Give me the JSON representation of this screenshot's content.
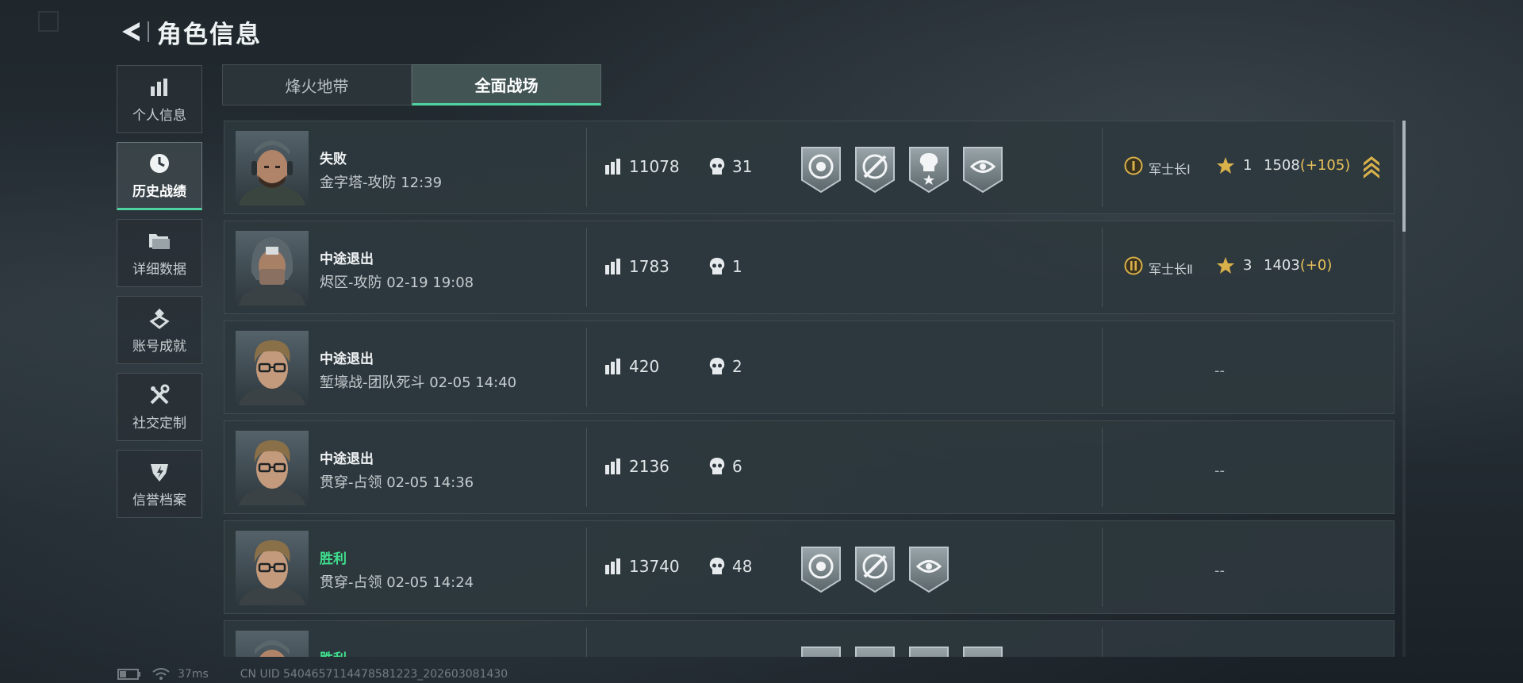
{
  "header": {
    "title": "角色信息",
    "back_icon": "back-arrow-icon"
  },
  "sidebar": {
    "items": [
      {
        "label": "个人信息",
        "icon": "bar-chart-icon",
        "active": false
      },
      {
        "label": "历史战绩",
        "icon": "clock-icon",
        "active": true
      },
      {
        "label": "详细数据",
        "icon": "folder-icon",
        "active": false
      },
      {
        "label": "账号成就",
        "icon": "achievement-icon",
        "active": false
      },
      {
        "label": "社交定制",
        "icon": "tools-icon",
        "active": false
      },
      {
        "label": "信誉档案",
        "icon": "reputation-icon",
        "active": false
      }
    ]
  },
  "tabs": [
    {
      "label": "烽火地带",
      "active": false
    },
    {
      "label": "全面战场",
      "active": true
    }
  ],
  "matches": [
    {
      "result": "失败",
      "info": "金字塔-攻防 12:39",
      "score": "11078",
      "kills": "31",
      "medals": [
        "target-skull-medal-icon",
        "crosshair-rifle-medal-icon",
        "skull-star-medal-icon",
        "eye-scope-medal-icon"
      ],
      "rank": {
        "name": "军士长Ⅰ",
        "stars": "1",
        "rating": "1508",
        "delta": "(+105)"
      }
    },
    {
      "result": "中途退出",
      "info": "烬区-攻防 02-19 19:08",
      "score": "1783",
      "kills": "1",
      "medals": [],
      "rank": {
        "name": "军士长Ⅱ",
        "stars": "3",
        "rating": "1403",
        "delta": "(+0)"
      }
    },
    {
      "result": "中途退出",
      "info": "堑壕战-团队死斗 02-05 14:40",
      "score": "420",
      "kills": "2",
      "medals": [],
      "rank_empty": "--"
    },
    {
      "result": "中途退出",
      "info": "贯穿-占领 02-05 14:36",
      "score": "2136",
      "kills": "6",
      "medals": [],
      "rank_empty": "--"
    },
    {
      "result": "胜利",
      "info": "贯穿-占领 02-05 14:24",
      "score": "13740",
      "kills": "48",
      "medals": [
        "target-skull-medal-icon",
        "crosshair-rifle-medal-icon",
        "eye-scope-medal-icon"
      ],
      "rank_empty": "--"
    },
    {
      "result": "胜利",
      "info": "",
      "score": "",
      "kills": "",
      "medals": [],
      "rank_empty": ""
    }
  ],
  "footer": {
    "latency": "37ms",
    "uid": "CN UID 5404657114478581223_202603081430"
  },
  "colors": {
    "accent": "#4fd3a1",
    "win": "#3fe08e",
    "gold": "#e8c25a"
  }
}
